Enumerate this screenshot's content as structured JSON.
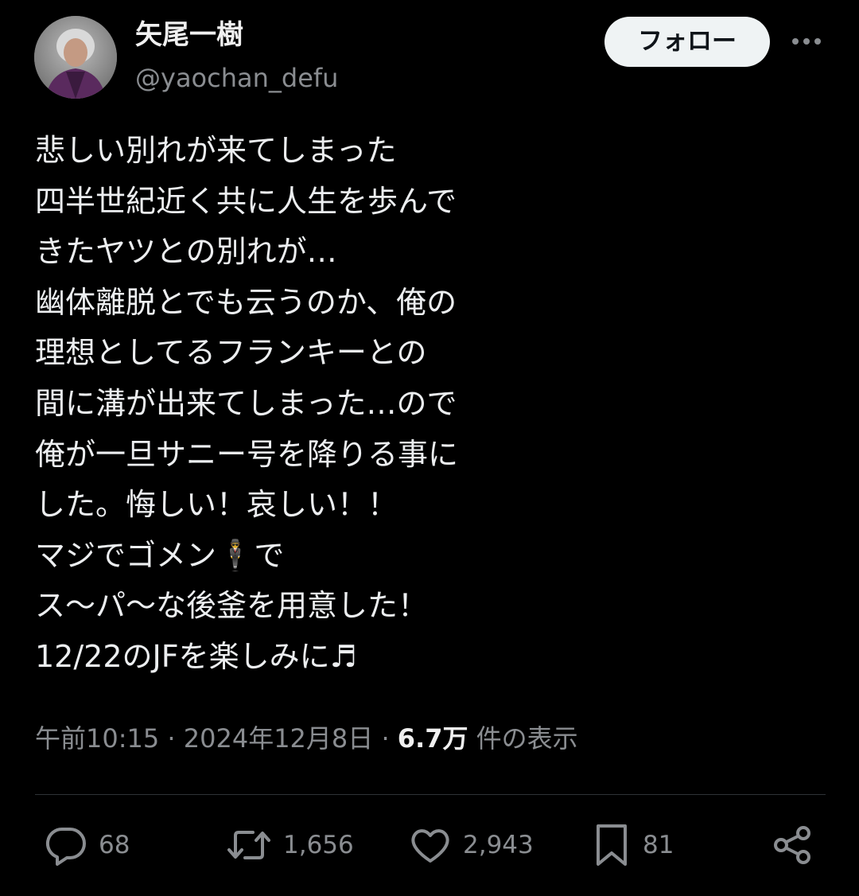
{
  "author": {
    "display_name": "矢尾一樹",
    "handle": "@yaochan_defu"
  },
  "follow_button_label": "フォロー",
  "tweet": {
    "lines": [
      "悲しい別れが来てしまった",
      "四半世紀近く共に人生を歩んで",
      "きたヤツとの別れが…",
      "幽体離脱とでも云うのか、俺の",
      "理想としてるフランキーとの",
      "間に溝が出来てしまった…ので",
      "俺が一旦サニー号を降りる事に",
      "した。悔しい！哀しい！！",
      "マジでゴメン🕴️で",
      "ス〜パ〜な後釜を用意した！",
      "12/22のJFを楽しみに♬"
    ]
  },
  "meta": {
    "time": "午前10:15",
    "separator": " · ",
    "date": "2024年12月8日",
    "views_count": "6.7万",
    "views_label": " 件の表示"
  },
  "actions": {
    "replies": "68",
    "retweets": "1,656",
    "likes": "2,943",
    "bookmarks": "81"
  },
  "colors": {
    "background": "#000000",
    "text": "#e7e9ea",
    "secondary_text": "#8a8d91",
    "divider": "#2f3336",
    "follow_button_bg": "#eff3f4"
  },
  "icons": [
    "reply-icon",
    "retweet-icon",
    "like-icon",
    "bookmark-icon",
    "share-icon",
    "more-icon"
  ]
}
